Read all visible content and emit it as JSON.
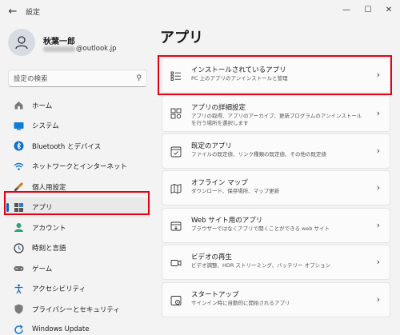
{
  "window": {
    "title": "設定"
  },
  "profile": {
    "name": "秋葉一郎",
    "email_suffix": "@outlook.jp"
  },
  "search": {
    "placeholder": "設定の検索"
  },
  "nav": [
    {
      "label": "ホーム",
      "icon": "home-icon"
    },
    {
      "label": "システム",
      "icon": "system-icon"
    },
    {
      "label": "Bluetooth とデバイス",
      "icon": "bluetooth-icon"
    },
    {
      "label": "ネットワークとインターネット",
      "icon": "wifi-icon"
    },
    {
      "label": "個人用設定",
      "icon": "brush-icon"
    },
    {
      "label": "アプリ",
      "icon": "apps-icon"
    },
    {
      "label": "アカウント",
      "icon": "account-icon"
    },
    {
      "label": "時刻と言語",
      "icon": "time-language-icon"
    },
    {
      "label": "ゲーム",
      "icon": "gamepad-icon"
    },
    {
      "label": "アクセシビリティ",
      "icon": "accessibility-icon"
    },
    {
      "label": "プライバシーとセキュリティ",
      "icon": "shield-icon"
    },
    {
      "label": "Windows Update",
      "icon": "update-icon"
    }
  ],
  "main": {
    "title": "アプリ",
    "cards": [
      {
        "title": "インストールされているアプリ",
        "desc": "PC 上のアプリのアンインストールと管理",
        "icon": "app-list-icon"
      },
      {
        "title": "アプリの詳細設定",
        "desc": "アプリの取得、アプリのアーカイブ、更新プログラムのアンインストールを行う場所を選択します",
        "icon": "advanced-apps-icon"
      },
      {
        "title": "既定のアプリ",
        "desc": "ファイルの既定値、リンク種類の既定値、その他の既定値",
        "icon": "default-apps-icon"
      },
      {
        "title": "オフライン マップ",
        "desc": "ダウンロード、保存場所、マップ更新",
        "icon": "offline-maps-icon"
      },
      {
        "title": "Web サイト用のアプリ",
        "desc": "ブラウザーではなくアプリで開くことができる web サイト",
        "icon": "web-apps-icon"
      },
      {
        "title": "ビデオの再生",
        "desc": "ビデオ調整、HDR ストリーミング、バッテリー オプション",
        "icon": "video-icon"
      },
      {
        "title": "スタートアップ",
        "desc": "サインイン時に自動的に開始されるアプリ",
        "icon": "startup-icon"
      }
    ]
  },
  "colors": {
    "accent": "#0067c0",
    "highlight": "#e50012"
  }
}
